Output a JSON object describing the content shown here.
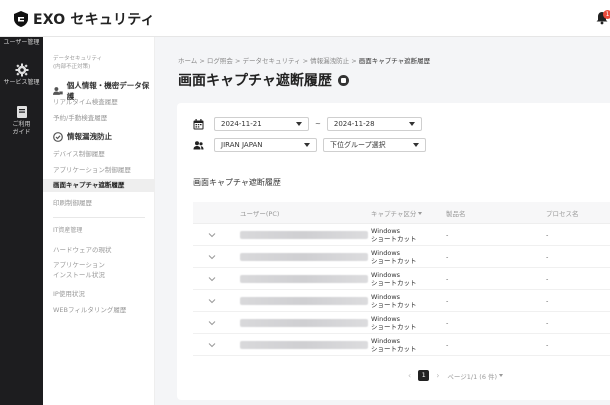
{
  "app": {
    "brand": "EXO セキュリティ",
    "notification_count": "1"
  },
  "rail": {
    "items": [
      {
        "label": "ユーザー管理",
        "icon": "user-admin-icon"
      },
      {
        "label": "サービス管理",
        "icon": "gear-icon"
      },
      {
        "label": "ご利用ガイド",
        "icon": "guide-icon"
      }
    ]
  },
  "sidebar": {
    "top_small": "データセキュリティ\n(内部不正対策)",
    "group1": "個人情報・機密データ保護",
    "group1_links": [
      "リアルタイム検査履歴",
      "予約/手動検査履歴"
    ],
    "group2": "情報漏洩防止",
    "group2_links": [
      "デバイス制御履歴",
      "アプリケーション制御履歴",
      "画面キャプチャ遮断履歴",
      "印刷制御履歴"
    ],
    "active_link": "画面キャプチャ遮断履歴",
    "section2": "IT資産管理",
    "section2_links": [
      "ハードウェアの現状",
      "アプリケーション\nインストール状況",
      "IP使用状況",
      "WEBフィルタリング履歴"
    ]
  },
  "breadcrumb": {
    "path": "ホーム > ログ照会 > データセキュリティ > 情報漏洩防止 > ",
    "current": "画面キャプチャ遮断履歴"
  },
  "page_title": "画面キャプチャ遮断履歴",
  "filters": {
    "date_from": "2024-11-21",
    "date_sep": "~",
    "date_to": "2024-11-28",
    "group": "JIRAN JAPAN",
    "subgroup": "下位グループ選択"
  },
  "section_title": "画面キャプチャ遮断履歴",
  "table": {
    "headers": {
      "user": "ユーザー(PC)",
      "type": "キャプチャ区分",
      "product": "製品名",
      "process": "プロセス名"
    },
    "rows": [
      {
        "type_line1": "Windows",
        "type_line2": "ショートカット",
        "product": "-",
        "process": "-"
      },
      {
        "type_line1": "Windows",
        "type_line2": "ショートカット",
        "product": "-",
        "process": "-"
      },
      {
        "type_line1": "Windows",
        "type_line2": "ショートカット",
        "product": "-",
        "process": "-"
      },
      {
        "type_line1": "Windows",
        "type_line2": "ショートカット",
        "product": "-",
        "process": "-"
      },
      {
        "type_line1": "Windows",
        "type_line2": "ショートカット",
        "product": "-",
        "process": "-"
      },
      {
        "type_line1": "Windows",
        "type_line2": "ショートカット",
        "product": "-",
        "process": "-"
      }
    ]
  },
  "pagination": {
    "current_page": "1",
    "info": "ページ1/1 (6 件)"
  },
  "colors": {
    "accent_dark": "#222222",
    "rail_bg": "#1d1d1f",
    "badge": "#e94b3c"
  }
}
